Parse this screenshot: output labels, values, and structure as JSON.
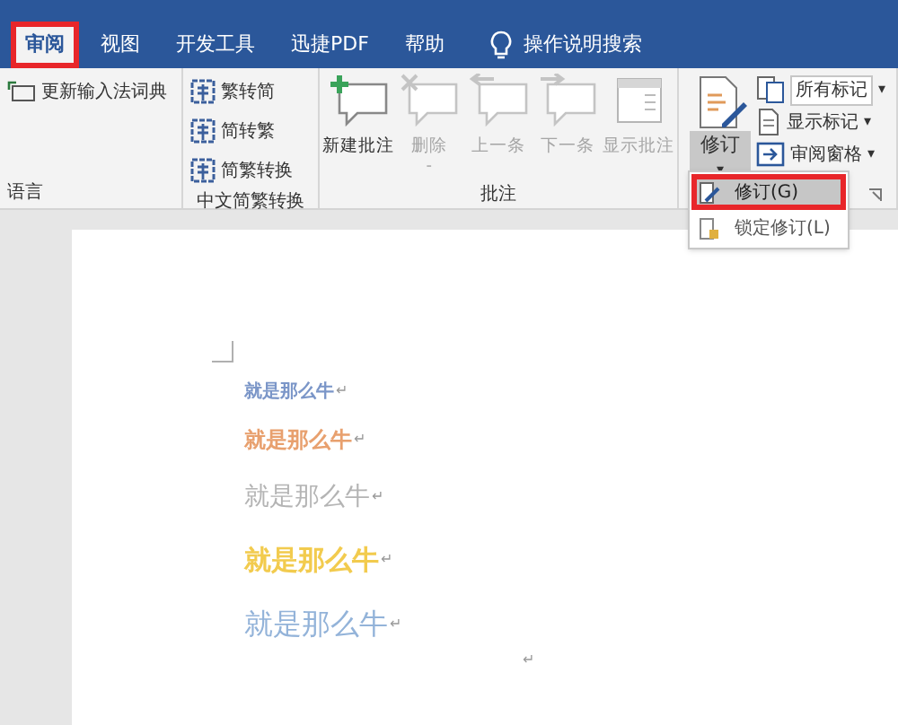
{
  "tabs": [
    {
      "label": "审阅",
      "selected": true,
      "highlighted": true
    },
    {
      "label": "视图",
      "selected": false,
      "highlighted": false
    },
    {
      "label": "开发工具",
      "selected": false,
      "highlighted": false
    },
    {
      "label": "迅捷PDF",
      "selected": false,
      "highlighted": false
    },
    {
      "label": "帮助",
      "selected": false,
      "highlighted": false
    }
  ],
  "tell_me": {
    "label": "操作说明搜索"
  },
  "groups": [
    {
      "label": "语言",
      "items": [
        {
          "kind": "small",
          "label": "更新输入法词典",
          "disabled": false
        }
      ]
    },
    {
      "label": "中文简繁转换",
      "items": [
        {
          "kind": "small",
          "label": "繁转简",
          "disabled": false
        },
        {
          "kind": "small",
          "label": "简转繁",
          "disabled": false
        },
        {
          "kind": "small",
          "label": "简繁转换",
          "disabled": false
        }
      ]
    },
    {
      "label": "批注",
      "items": [
        {
          "kind": "large",
          "label": "新建批注",
          "disabled": false
        },
        {
          "kind": "large",
          "label": "删除",
          "disabled": true,
          "caret": "-"
        },
        {
          "kind": "large",
          "label": "上一条",
          "disabled": true
        },
        {
          "kind": "large",
          "label": "下一条",
          "disabled": true
        },
        {
          "kind": "large",
          "label": "显示批注",
          "disabled": true
        }
      ]
    },
    {
      "items": [
        {
          "kind": "split",
          "label": "修订",
          "caret": "▾",
          "pressed": true
        },
        {
          "kind": "dropdown",
          "label": "所有标记",
          "caret": "▾"
        },
        {
          "kind": "small",
          "label": "显示标记",
          "caret": "▾",
          "disabled": false
        },
        {
          "kind": "small",
          "label": "审阅窗格",
          "caret": "▾",
          "disabled": false
        }
      ]
    }
  ],
  "menu": [
    {
      "label": "修订(G)",
      "selected": true,
      "highlighted": true
    },
    {
      "label": "锁定修订(L)",
      "selected": false,
      "highlighted": false
    }
  ],
  "document": {
    "lines": [
      {
        "text": "就是那么牛",
        "mark": "↵",
        "color": "#7b96c8"
      },
      {
        "text": "就是那么牛",
        "mark": "↵",
        "color": "#e8a06e"
      },
      {
        "text": "就是那么牛",
        "mark": "↵",
        "color": "#b4b4b4"
      },
      {
        "text": "就是那么牛",
        "mark": "↵",
        "color": "#f2cb4e"
      },
      {
        "text": "就是那么牛",
        "mark": "↵",
        "color": "#93b3d9"
      }
    ],
    "end_mark": "↵"
  }
}
